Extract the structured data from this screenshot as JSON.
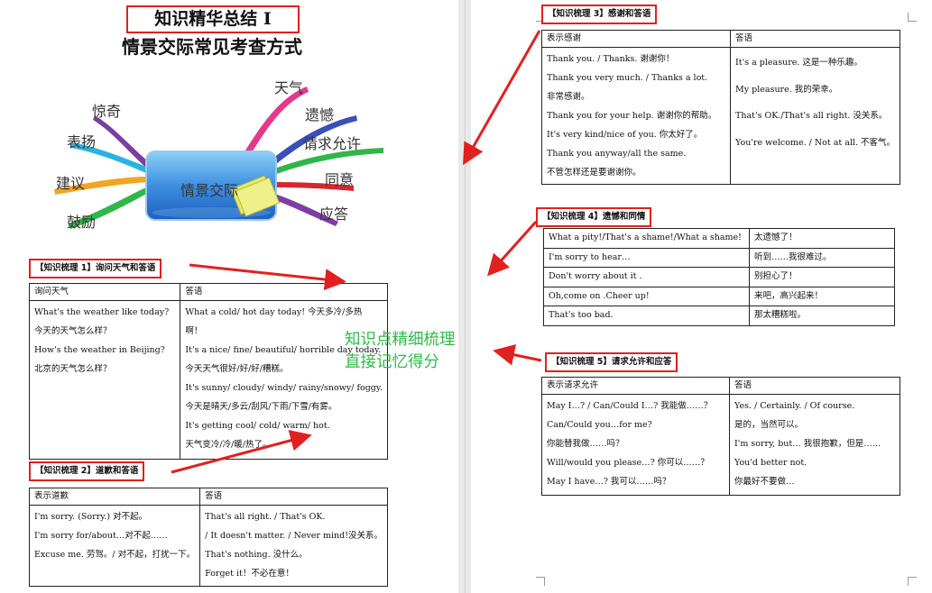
{
  "title": "知识精华总结 I",
  "subtitle": "情景交际常见考查方式",
  "mindmap": {
    "center": "情景交际",
    "left": [
      "惊奇",
      "表扬",
      "建议",
      "鼓励"
    ],
    "right": [
      "天气",
      "遗憾",
      "请求允许",
      "同意",
      "应答"
    ]
  },
  "note": {
    "line1": "知识点精细梳理",
    "line2": "直接记忆得分"
  },
  "sec1": {
    "heading": "【知识梳理 1】询问天气和答语",
    "col1": "询问天气",
    "col2": "答语",
    "left_rows": [
      "What's the weather like today?",
      "今天的天气怎么样？",
      "How's the weather in Beijing?",
      "北京的天气怎么样？"
    ],
    "right_rows": [
      "What a cold/ hot day today!  今天多冷/多热",
      "啊！",
      "It's a nice/ fine/ beautiful/ horrible day today.",
      "今天天气很好/好/好/糟糕。",
      "It's sunny/ cloudy/ windy/ rainy/snowy/ foggy.",
      "今天是晴天/多云/刮风/下雨/下雪/有雾。",
      "It's getting cool/ cold/ warm/ hot.",
      "天气变冷/冷/暖/热了。"
    ]
  },
  "sec2": {
    "heading": "【知识梳理 2】道歉和答语",
    "col1": "表示道歉",
    "col2": "答语",
    "left_rows": [
      "I'm sorry. (Sorry.)  对不起。",
      "I'm sorry for/about…对不起……",
      "Excuse me. 劳驾。/ 对不起，打扰一下。"
    ],
    "right_rows": [
      "That's all right. / That's OK.",
      "/ It doesn't matter. / Never mind!没关系。",
      "That's nothing.  没什么。",
      "Forget it！不必在意！"
    ]
  },
  "sec3": {
    "heading": "【知识梳理 3】感谢和答语",
    "col1": "表示感谢",
    "col2": "答语",
    "left_rows": [
      "Thank you. / Thanks.  谢谢你！",
      "Thank you very much. / Thanks a lot.",
      "非常感谢。",
      "Thank you for your help.  谢谢你的帮助。",
      "It's very kind/nice of you.    你太好了。",
      "Thank you anyway/all the same.",
      "不管怎样还是要谢谢你。"
    ],
    "right_rows": [
      "It's a pleasure.  这是一种乐趣。",
      "My pleasure.  我的荣幸。",
      "That's OK./That's all right.  没关系。",
      "You're welcome. / Not at all.  不客气。"
    ]
  },
  "sec4": {
    "heading": "【知识梳理 4】遗憾和同情",
    "rows": [
      [
        "What a pity!/That's a shame!/What a shame!",
        "太遗憾了！"
      ],
      [
        "I'm sorry to hear…",
        "听到……我很难过。"
      ],
      [
        "Don't worry about it .",
        "别担心了！"
      ],
      [
        "Oh,come on .Cheer up!",
        "来吧，高兴起来！"
      ],
      [
        "That's too bad.",
        "那太糟糕啦。"
      ]
    ]
  },
  "sec5": {
    "heading": "【知识梳理 5】请求允许和应答",
    "col1": "表示请求允许",
    "col2": "答语",
    "left_rows": [
      "May I…? / Can/Could I…?  我能做……？",
      "Can/Could you…for me?",
      "你能替我做……吗？",
      "Will/would you please…?    你可以……？",
      "May I have…?  我可以……吗？"
    ],
    "right_rows": [
      "Yes. / Certainly. / Of course.",
      "是的，当然可以。",
      "I'm sorry, but…  我很抱歉，但是……",
      "You'd better not.",
      "你最好不要做…"
    ]
  },
  "colors": {
    "accent_red": "#e0211f",
    "note_green": "#2fba4a"
  }
}
